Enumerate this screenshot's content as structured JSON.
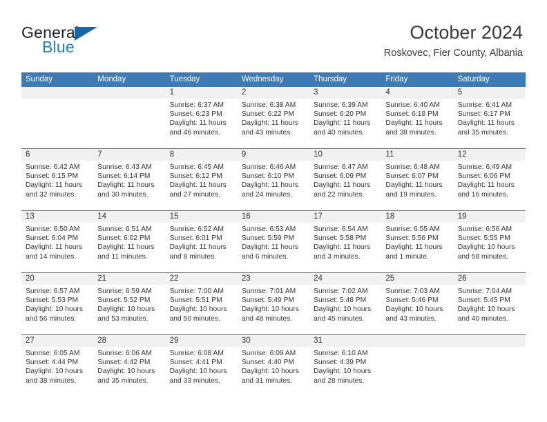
{
  "brand": {
    "line1": "General",
    "line2": "Blue",
    "accent_color": "#1c7fc4",
    "triangle_color": "#1566ab"
  },
  "header": {
    "title": "October 2024",
    "subtitle": "Roskovec, Fier County, Albania"
  },
  "calendar": {
    "header_color": "#3b7cb8",
    "weekdays": [
      "Sunday",
      "Monday",
      "Tuesday",
      "Wednesday",
      "Thursday",
      "Friday",
      "Saturday"
    ],
    "weeks": [
      [
        {
          "day": "",
          "sunrise": "",
          "sunset": "",
          "daylight": ""
        },
        {
          "day": "",
          "sunrise": "",
          "sunset": "",
          "daylight": ""
        },
        {
          "day": "1",
          "sunrise": "Sunrise: 6:37 AM",
          "sunset": "Sunset: 6:23 PM",
          "daylight": "Daylight: 11 hours and 46 minutes."
        },
        {
          "day": "2",
          "sunrise": "Sunrise: 6:38 AM",
          "sunset": "Sunset: 6:22 PM",
          "daylight": "Daylight: 11 hours and 43 minutes."
        },
        {
          "day": "3",
          "sunrise": "Sunrise: 6:39 AM",
          "sunset": "Sunset: 6:20 PM",
          "daylight": "Daylight: 11 hours and 40 minutes."
        },
        {
          "day": "4",
          "sunrise": "Sunrise: 6:40 AM",
          "sunset": "Sunset: 6:18 PM",
          "daylight": "Daylight: 11 hours and 38 minutes."
        },
        {
          "day": "5",
          "sunrise": "Sunrise: 6:41 AM",
          "sunset": "Sunset: 6:17 PM",
          "daylight": "Daylight: 11 hours and 35 minutes."
        }
      ],
      [
        {
          "day": "6",
          "sunrise": "Sunrise: 6:42 AM",
          "sunset": "Sunset: 6:15 PM",
          "daylight": "Daylight: 11 hours and 32 minutes."
        },
        {
          "day": "7",
          "sunrise": "Sunrise: 6:43 AM",
          "sunset": "Sunset: 6:14 PM",
          "daylight": "Daylight: 11 hours and 30 minutes."
        },
        {
          "day": "8",
          "sunrise": "Sunrise: 6:45 AM",
          "sunset": "Sunset: 6:12 PM",
          "daylight": "Daylight: 11 hours and 27 minutes."
        },
        {
          "day": "9",
          "sunrise": "Sunrise: 6:46 AM",
          "sunset": "Sunset: 6:10 PM",
          "daylight": "Daylight: 11 hours and 24 minutes."
        },
        {
          "day": "10",
          "sunrise": "Sunrise: 6:47 AM",
          "sunset": "Sunset: 6:09 PM",
          "daylight": "Daylight: 11 hours and 22 minutes."
        },
        {
          "day": "11",
          "sunrise": "Sunrise: 6:48 AM",
          "sunset": "Sunset: 6:07 PM",
          "daylight": "Daylight: 11 hours and 19 minutes."
        },
        {
          "day": "12",
          "sunrise": "Sunrise: 6:49 AM",
          "sunset": "Sunset: 6:06 PM",
          "daylight": "Daylight: 11 hours and 16 minutes."
        }
      ],
      [
        {
          "day": "13",
          "sunrise": "Sunrise: 6:50 AM",
          "sunset": "Sunset: 6:04 PM",
          "daylight": "Daylight: 11 hours and 14 minutes."
        },
        {
          "day": "14",
          "sunrise": "Sunrise: 6:51 AM",
          "sunset": "Sunset: 6:02 PM",
          "daylight": "Daylight: 11 hours and 11 minutes."
        },
        {
          "day": "15",
          "sunrise": "Sunrise: 6:52 AM",
          "sunset": "Sunset: 6:01 PM",
          "daylight": "Daylight: 11 hours and 8 minutes."
        },
        {
          "day": "16",
          "sunrise": "Sunrise: 6:53 AM",
          "sunset": "Sunset: 5:59 PM",
          "daylight": "Daylight: 11 hours and 6 minutes."
        },
        {
          "day": "17",
          "sunrise": "Sunrise: 6:54 AM",
          "sunset": "Sunset: 5:58 PM",
          "daylight": "Daylight: 11 hours and 3 minutes."
        },
        {
          "day": "18",
          "sunrise": "Sunrise: 6:55 AM",
          "sunset": "Sunset: 5:56 PM",
          "daylight": "Daylight: 11 hours and 1 minute."
        },
        {
          "day": "19",
          "sunrise": "Sunrise: 6:56 AM",
          "sunset": "Sunset: 5:55 PM",
          "daylight": "Daylight: 10 hours and 58 minutes."
        }
      ],
      [
        {
          "day": "20",
          "sunrise": "Sunrise: 6:57 AM",
          "sunset": "Sunset: 5:53 PM",
          "daylight": "Daylight: 10 hours and 56 minutes."
        },
        {
          "day": "21",
          "sunrise": "Sunrise: 6:59 AM",
          "sunset": "Sunset: 5:52 PM",
          "daylight": "Daylight: 10 hours and 53 minutes."
        },
        {
          "day": "22",
          "sunrise": "Sunrise: 7:00 AM",
          "sunset": "Sunset: 5:51 PM",
          "daylight": "Daylight: 10 hours and 50 minutes."
        },
        {
          "day": "23",
          "sunrise": "Sunrise: 7:01 AM",
          "sunset": "Sunset: 5:49 PM",
          "daylight": "Daylight: 10 hours and 48 minutes."
        },
        {
          "day": "24",
          "sunrise": "Sunrise: 7:02 AM",
          "sunset": "Sunset: 5:48 PM",
          "daylight": "Daylight: 10 hours and 45 minutes."
        },
        {
          "day": "25",
          "sunrise": "Sunrise: 7:03 AM",
          "sunset": "Sunset: 5:46 PM",
          "daylight": "Daylight: 10 hours and 43 minutes."
        },
        {
          "day": "26",
          "sunrise": "Sunrise: 7:04 AM",
          "sunset": "Sunset: 5:45 PM",
          "daylight": "Daylight: 10 hours and 40 minutes."
        }
      ],
      [
        {
          "day": "27",
          "sunrise": "Sunrise: 6:05 AM",
          "sunset": "Sunset: 4:44 PM",
          "daylight": "Daylight: 10 hours and 38 minutes."
        },
        {
          "day": "28",
          "sunrise": "Sunrise: 6:06 AM",
          "sunset": "Sunset: 4:42 PM",
          "daylight": "Daylight: 10 hours and 35 minutes."
        },
        {
          "day": "29",
          "sunrise": "Sunrise: 6:08 AM",
          "sunset": "Sunset: 4:41 PM",
          "daylight": "Daylight: 10 hours and 33 minutes."
        },
        {
          "day": "30",
          "sunrise": "Sunrise: 6:09 AM",
          "sunset": "Sunset: 4:40 PM",
          "daylight": "Daylight: 10 hours and 31 minutes."
        },
        {
          "day": "31",
          "sunrise": "Sunrise: 6:10 AM",
          "sunset": "Sunset: 4:39 PM",
          "daylight": "Daylight: 10 hours and 28 minutes."
        },
        {
          "day": "",
          "sunrise": "",
          "sunset": "",
          "daylight": ""
        },
        {
          "day": "",
          "sunrise": "",
          "sunset": "",
          "daylight": ""
        }
      ]
    ]
  }
}
